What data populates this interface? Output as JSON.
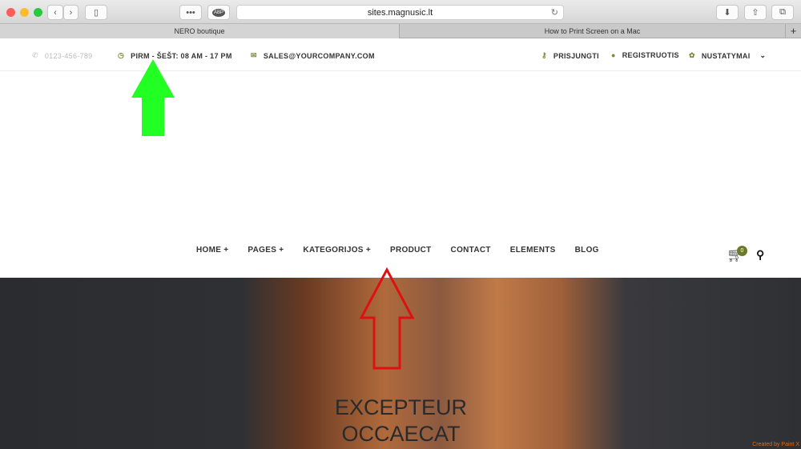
{
  "browser": {
    "url": "sites.magnusic.lt",
    "tabs": [
      "NERO boutique",
      "How to Print Screen on a Mac"
    ],
    "adblock_label": "ABP"
  },
  "topbar": {
    "phone": "0123-456-789",
    "hours": "PIRM - ŠEŠT: 08 AM - 17 PM",
    "email": "SALES@YOURCOMPANY.COM",
    "login": "PRISJUNGTI",
    "register": "REGISTRUOTIS",
    "settings": "NUSTATYMAI"
  },
  "nav": {
    "items": [
      "HOME +",
      "PAGES +",
      "KATEGORIJOS +",
      "PRODUCT",
      "CONTACT",
      "ELEMENTS",
      "BLOG"
    ],
    "cart_count": "0"
  },
  "hero": {
    "line1": "EXCEPTEUR",
    "line2": "OCCAECAT"
  },
  "watermark": "Created by Paint X",
  "colors": {
    "accent": "#6b7a2a",
    "green_arrow": "#22ff22",
    "red_arrow": "#e01010"
  }
}
